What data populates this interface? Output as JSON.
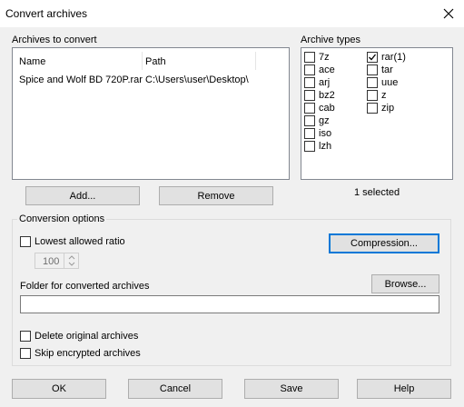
{
  "window": {
    "title": "Convert archives"
  },
  "archives": {
    "section_label": "Archives to convert",
    "columns": [
      "Name",
      "Path"
    ],
    "rows": [
      {
        "name": "Spice and Wolf BD 720P.rar",
        "path": "C:\\Users\\user\\Desktop\\"
      }
    ],
    "add_label": "Add...",
    "remove_label": "Remove"
  },
  "types": {
    "section_label": "Archive types",
    "left": [
      {
        "label": "7z",
        "checked": false
      },
      {
        "label": "ace",
        "checked": false
      },
      {
        "label": "arj",
        "checked": false
      },
      {
        "label": "bz2",
        "checked": false
      },
      {
        "label": "cab",
        "checked": false
      },
      {
        "label": "gz",
        "checked": false
      },
      {
        "label": "iso",
        "checked": false
      },
      {
        "label": "lzh",
        "checked": false
      }
    ],
    "right": [
      {
        "label": "rar(1)",
        "checked": true
      },
      {
        "label": "tar",
        "checked": false
      },
      {
        "label": "uue",
        "checked": false
      },
      {
        "label": "z",
        "checked": false
      },
      {
        "label": "zip",
        "checked": false
      }
    ],
    "selected_status": "1 selected"
  },
  "options": {
    "section_label": "Conversion options",
    "lowest_ratio_label": "Lowest allowed ratio",
    "lowest_ratio_checked": false,
    "ratio_value": "100",
    "compression_label": "Compression...",
    "folder_label": "Folder for converted archives",
    "browse_label": "Browse...",
    "folder_value": "",
    "delete_original_label": "Delete original archives",
    "delete_original_checked": false,
    "skip_encrypted_label": "Skip encrypted archives",
    "skip_encrypted_checked": false
  },
  "buttons": {
    "ok": "OK",
    "cancel": "Cancel",
    "save": "Save",
    "help": "Help"
  }
}
